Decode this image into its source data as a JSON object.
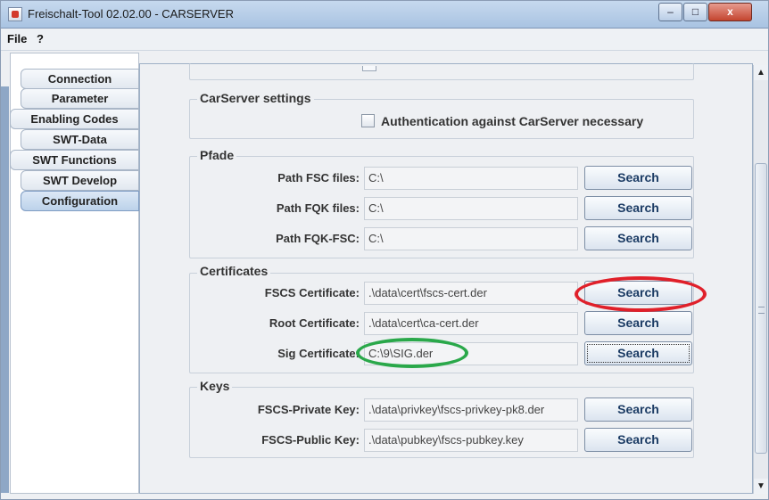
{
  "window": {
    "title": "Freischalt-Tool 02.02.00 - CARSERVER",
    "controls": {
      "minimize": "‒",
      "maximize": "□",
      "close": "x"
    }
  },
  "menu": [
    "File",
    "?"
  ],
  "tabs": [
    "Connection",
    "Parameter",
    "Enabling Codes",
    "SWT-Data",
    "SWT Functions",
    "SWT Develop",
    "Configuration"
  ],
  "active_tab": "Configuration",
  "carserver": {
    "title": "CarServer settings",
    "auth_label": "Authentication against CarServer necessary"
  },
  "pfade": {
    "title": "Pfade",
    "rows": [
      {
        "label": "Path FSC files:",
        "value": "C:\\"
      },
      {
        "label": "Path FQK files:",
        "value": "C:\\"
      },
      {
        "label": "Path FQK-FSC:",
        "value": "C:\\"
      }
    ]
  },
  "certificates": {
    "title": "Certificates",
    "rows": [
      {
        "label": "FSCS Certificate:",
        "value": ".\\data\\cert\\fscs-cert.der"
      },
      {
        "label": "Root Certificate:",
        "value": ".\\data\\cert\\ca-cert.der"
      },
      {
        "label": "Sig Certificate:",
        "value": "C:\\9\\SIG.der"
      }
    ]
  },
  "keys": {
    "title": "Keys",
    "rows": [
      {
        "label": "FSCS-Private Key:",
        "value": ".\\data\\privkey\\fscs-privkey-pk8.der"
      },
      {
        "label": "FSCS-Public Key:",
        "value": ".\\data\\pubkey\\fscs-pubkey.key"
      }
    ]
  },
  "search_label": "Search",
  "scrollbar": {
    "up": "▲",
    "down": "▼"
  },
  "annotation_colors": {
    "red": "#e0202a",
    "green": "#2aa84a"
  }
}
